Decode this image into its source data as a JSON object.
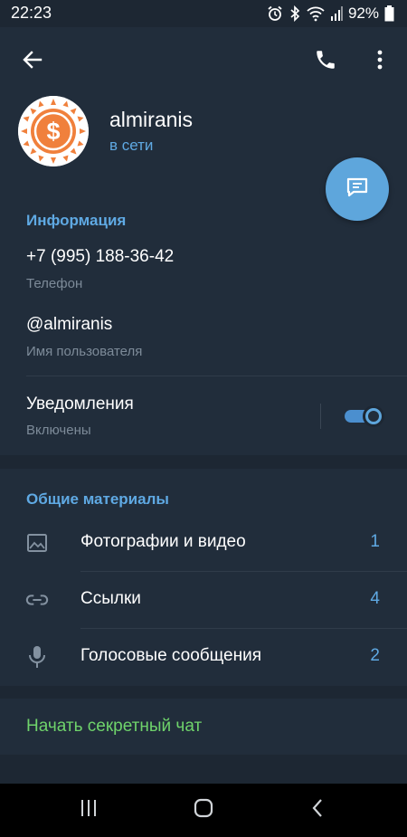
{
  "status_bar": {
    "time": "22:23",
    "battery_percent": "92%",
    "icons": [
      "alarm-icon",
      "bluetooth-icon",
      "wifi-icon",
      "signal-icon",
      "battery-icon"
    ]
  },
  "header": {
    "back_icon": "arrow-left-icon",
    "call_icon": "phone-icon",
    "more_icon": "more-vertical-icon",
    "contact_name": "almiranis",
    "contact_status": "в сети",
    "avatar_icon": "dollar-coin-icon"
  },
  "fab": {
    "icon": "message-icon"
  },
  "info": {
    "title": "Информация",
    "phone": {
      "value": "+7 (995) 188-36-42",
      "label": "Телефон"
    },
    "username": {
      "value": "@almiranis",
      "label": "Имя пользователя"
    },
    "notifications": {
      "value": "Уведомления",
      "label": "Включены",
      "enabled": true
    }
  },
  "shared": {
    "title": "Общие материалы",
    "items": [
      {
        "label": "Фотографии и видео",
        "count": "1",
        "icon": "image-icon"
      },
      {
        "label": "Ссылки",
        "count": "4",
        "icon": "link-icon"
      },
      {
        "label": "Голосовые сообщения",
        "count": "2",
        "icon": "microphone-icon"
      }
    ]
  },
  "secret_chat": {
    "label": "Начать секретный чат"
  },
  "colors": {
    "background": "#1d2733",
    "section": "#212d3b",
    "accent": "#5fa9e3",
    "fab": "#5ea6dc",
    "secret": "#6fd36b",
    "avatar_orange": "#f0803c"
  },
  "navbar": {
    "icons": [
      "recent-apps-icon",
      "home-icon",
      "back-nav-icon"
    ]
  }
}
